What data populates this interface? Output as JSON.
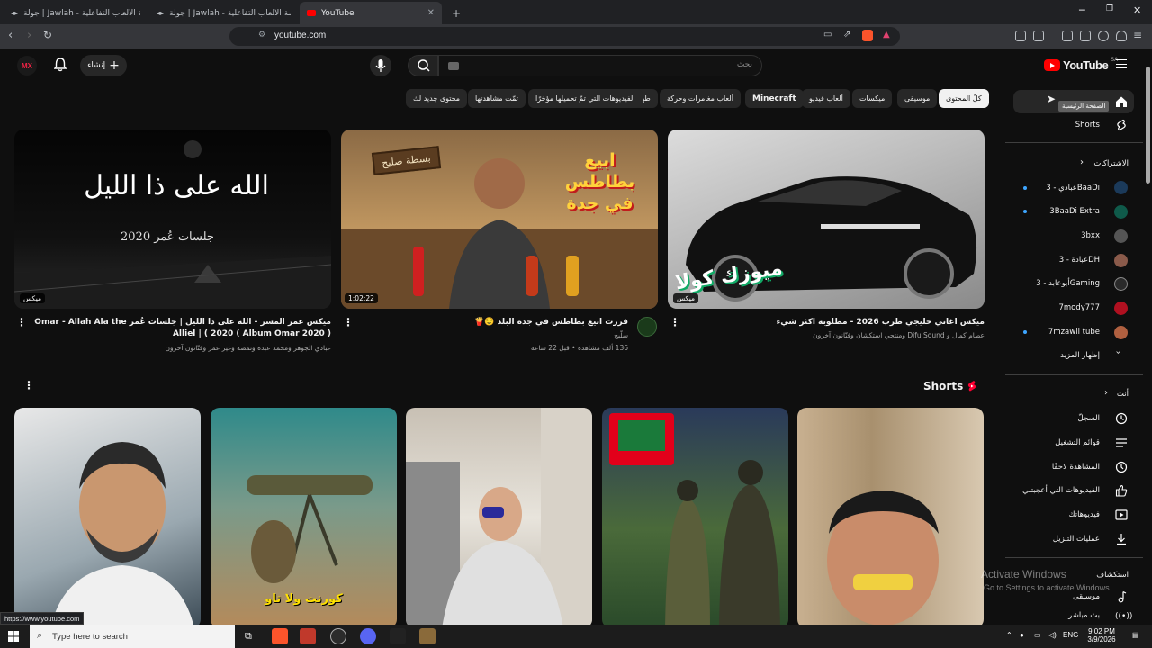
{
  "browser": {
    "tabs": [
      {
        "title": "جولة | Jawlah - منصة الألعاب التفاعلية"
      },
      {
        "title": "جولة | Jawlah - منصة الألعاب التفاعلية"
      },
      {
        "title": "YouTube"
      }
    ],
    "new_tab": "+",
    "url": "youtube.com",
    "status_url": "https://www.youtube.com"
  },
  "masthead": {
    "logo_text": "YouTube",
    "logo_region": "SA",
    "search_placeholder": "بحث",
    "create_label": "إنشاء",
    "avatar_text": "MX"
  },
  "chips": [
    {
      "label": "كلّ المحتوى",
      "active": true
    },
    {
      "label": "موسيقى"
    },
    {
      "label": "ميكسات"
    },
    {
      "label": "ألعاب فيديو"
    },
    {
      "label": "Minecraft"
    },
    {
      "label": "ألعاب مغامرات وحركة"
    },
    {
      "label": "طهي"
    },
    {
      "label": "الفيديوهات التي تمّ تحميلها مؤخرًا"
    },
    {
      "label": "تمّت مشاهدتها"
    },
    {
      "label": "محتوى جديد لك"
    }
  ],
  "guide": {
    "home_tooltip": "الصفحة الرئيسية",
    "shorts": "Shorts",
    "subs_header": "الاشتراكات",
    "subscriptions": [
      {
        "name": "عبادي - 3BaaDi",
        "dot": true
      },
      {
        "name": "3BaaDi Extra",
        "dot": true
      },
      {
        "name": "3bxx",
        "dot": false
      },
      {
        "name": "عبادة - 3DH",
        "dot": false
      },
      {
        "name": "أبوعابد - 3Gaming",
        "dot": false
      },
      {
        "name": "7mody777",
        "dot": false
      },
      {
        "name": "7mzawii tube",
        "dot": true
      }
    ],
    "show_more": "إظهار المزيد",
    "you_header": "أنت",
    "you_items": [
      "السجلّ",
      "قوائم التشغيل",
      "المشاهدة لاحقًا",
      "الفيديوهات التي أعجبتني",
      "فيديوهاتك",
      "عمليات التنزيل"
    ],
    "explore_header": "استكشاف",
    "explore_items": [
      "موسيقى",
      "بث مباشر"
    ]
  },
  "videos": [
    {
      "title": "ميكس اغاني خليجي طرب 2026 - مطلوبة اكثر شيء",
      "channel": "عصام كمال و Difu Sound ومنتجي استكشان وفنّانون آخرون",
      "stats": "",
      "badge": "ميكس",
      "thumb_text": "ميوزك كولا"
    },
    {
      "title": "قررت ابيع بطاطس في جدة البلد 🤤🍟",
      "channel": "سلّيح",
      "stats": "136 ألف مشاهدة • قبل 22 ساعة",
      "badge": "1:02:22",
      "thumb_text": "ابيع بطاطس في جدة",
      "thumb_sign": "بسطة صليح"
    },
    {
      "title": "ميكس عمر المسر - الله على ذا الليل | جلسات عُمر Omar - Allah Ala the Alliel | ( 2020 ( Album Omar 2020 )",
      "channel": "عبادي الجوهر ومحمد عبده وتمضة وغير عمر وفنّانون آخرون",
      "stats": "",
      "badge": "ميكس",
      "thumb_text": "الله على ذا الليل",
      "thumb_sub": "جلسات عُمر 2020"
    }
  ],
  "shorts": {
    "title": "Shorts",
    "items": [
      {
        "caption": ""
      },
      {
        "caption": ""
      },
      {
        "caption": ""
      },
      {
        "caption": "كورنت ولا تاو"
      },
      {
        "caption": ""
      }
    ]
  },
  "windows": {
    "watermark_title": "Activate Windows",
    "watermark_sub": "Go to Settings to activate Windows.",
    "search_placeholder": "Type here to search",
    "lang": "ENG",
    "time": "9:02 PM",
    "date": "3/9/2026"
  },
  "colors": {
    "bg": "#0f0f0f",
    "accent": "#ff0000",
    "chip": "#272727",
    "link": "#3ea6ff"
  }
}
